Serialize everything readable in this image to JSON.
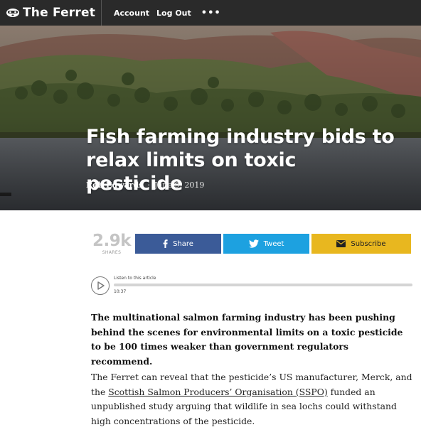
{
  "nav": {
    "brand": "The Ferret",
    "account": "Account",
    "logout": "Log Out",
    "more": "•••"
  },
  "hero": {
    "title": "Fish farming industry bids to relax limits on toxic pesticide",
    "author": "Rob Edwards",
    "separator": "·",
    "date": "June 9, 2019"
  },
  "share": {
    "count": "2.9k",
    "count_label": "SHARES",
    "facebook": "Share",
    "twitter": "Tweet",
    "subscribe": "Subscribe"
  },
  "audio": {
    "label": "Listen to this article",
    "duration": "10:37",
    "progress": 0
  },
  "article": {
    "lede": "The multinational salmon farming industry has been pushing behind the scenes for environmental limits on a toxic pesticide to be 100 times weaker than government regulators recommend.",
    "para1_before": "The Ferret can reveal that the pesticide’s US manufacturer, Merck, and the ",
    "para1_link": "Scottish Salmon Producers’ Organisation (SSPO)",
    "para1_after": " funded an unpublished study arguing that wildlife in sea lochs could withstand high concentrations of the pesticide."
  },
  "colors": {
    "topbar": "#2a2a2a",
    "facebook": "#3b5b98",
    "twitter": "#1da1e0",
    "subscribe": "#e8b71f"
  },
  "icons": {
    "brand": "ferret-icon",
    "facebook": "facebook-icon",
    "twitter": "twitter-icon",
    "subscribe": "envelope-icon",
    "play": "play-icon"
  }
}
